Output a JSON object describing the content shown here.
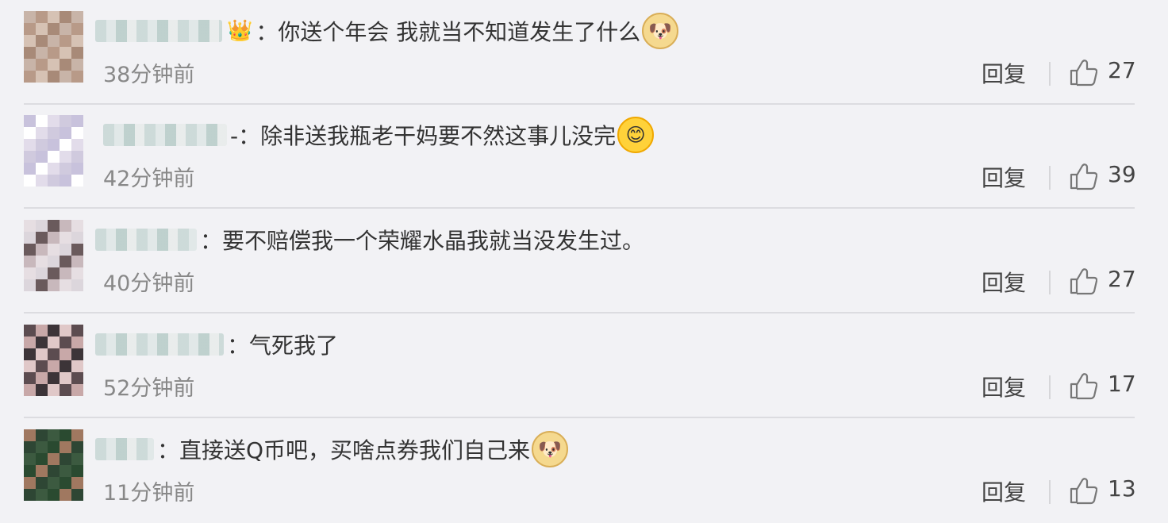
{
  "comments": [
    {
      "text": "：你送个年会 我就当不知道发生了什么",
      "emoji": "doge-emoji",
      "badge": "crown-heart-icon",
      "time": "38分钟前",
      "reply": "回复",
      "likes": "27"
    },
    {
      "text": "-：除非送我瓶老干妈要不然这事儿没完",
      "emoji": "smile-emoji",
      "time": "42分钟前",
      "reply": "回复",
      "likes": "39"
    },
    {
      "text": "：要不赔偿我一个荣耀水晶我就当没发生过。",
      "time": "40分钟前",
      "reply": "回复",
      "likes": "27"
    },
    {
      "text": "：气死我了",
      "time": "52分钟前",
      "reply": "回复",
      "likes": "17"
    },
    {
      "text": "：直接送Q币吧，买啥点券我们自己来",
      "emoji": "doge-emoji",
      "time": "11分钟前",
      "reply": "回复",
      "likes": "13"
    }
  ]
}
